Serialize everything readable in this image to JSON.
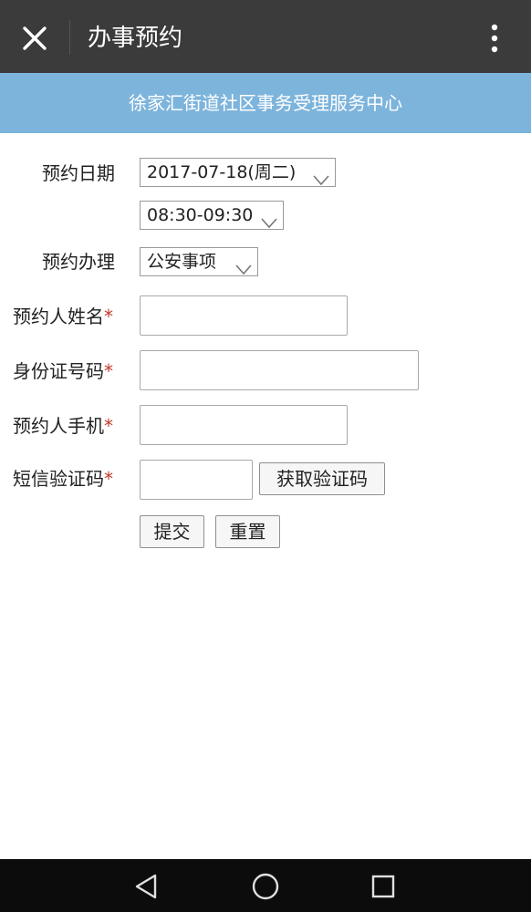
{
  "header": {
    "title": "办事预约",
    "close_icon": "close-icon",
    "more_icon": "more-vertical-icon"
  },
  "banner": {
    "text": "徐家汇街道社区事务受理服务中心",
    "bg_color": "#7db4dc"
  },
  "form": {
    "date_label": "预约日期",
    "date_value": "2017-07-18(周二)",
    "time_value": "08:30-09:30",
    "business_label": "预约办理",
    "business_value": "公安事项",
    "name_label": "预约人姓名",
    "id_label": "身份证号码",
    "phone_label": "预约人手机",
    "sms_label": "短信验证码",
    "required_mark": "*",
    "get_code_label": "获取验证码",
    "submit_label": "提交",
    "reset_label": "重置"
  },
  "navbar": {
    "back_icon": "back-triangle-icon",
    "home_icon": "home-circle-icon",
    "recents_icon": "recents-square-icon"
  },
  "colors": {
    "topbar": "#3b3b3b",
    "required": "#c0392b",
    "navbar": "#0c0c0c"
  }
}
